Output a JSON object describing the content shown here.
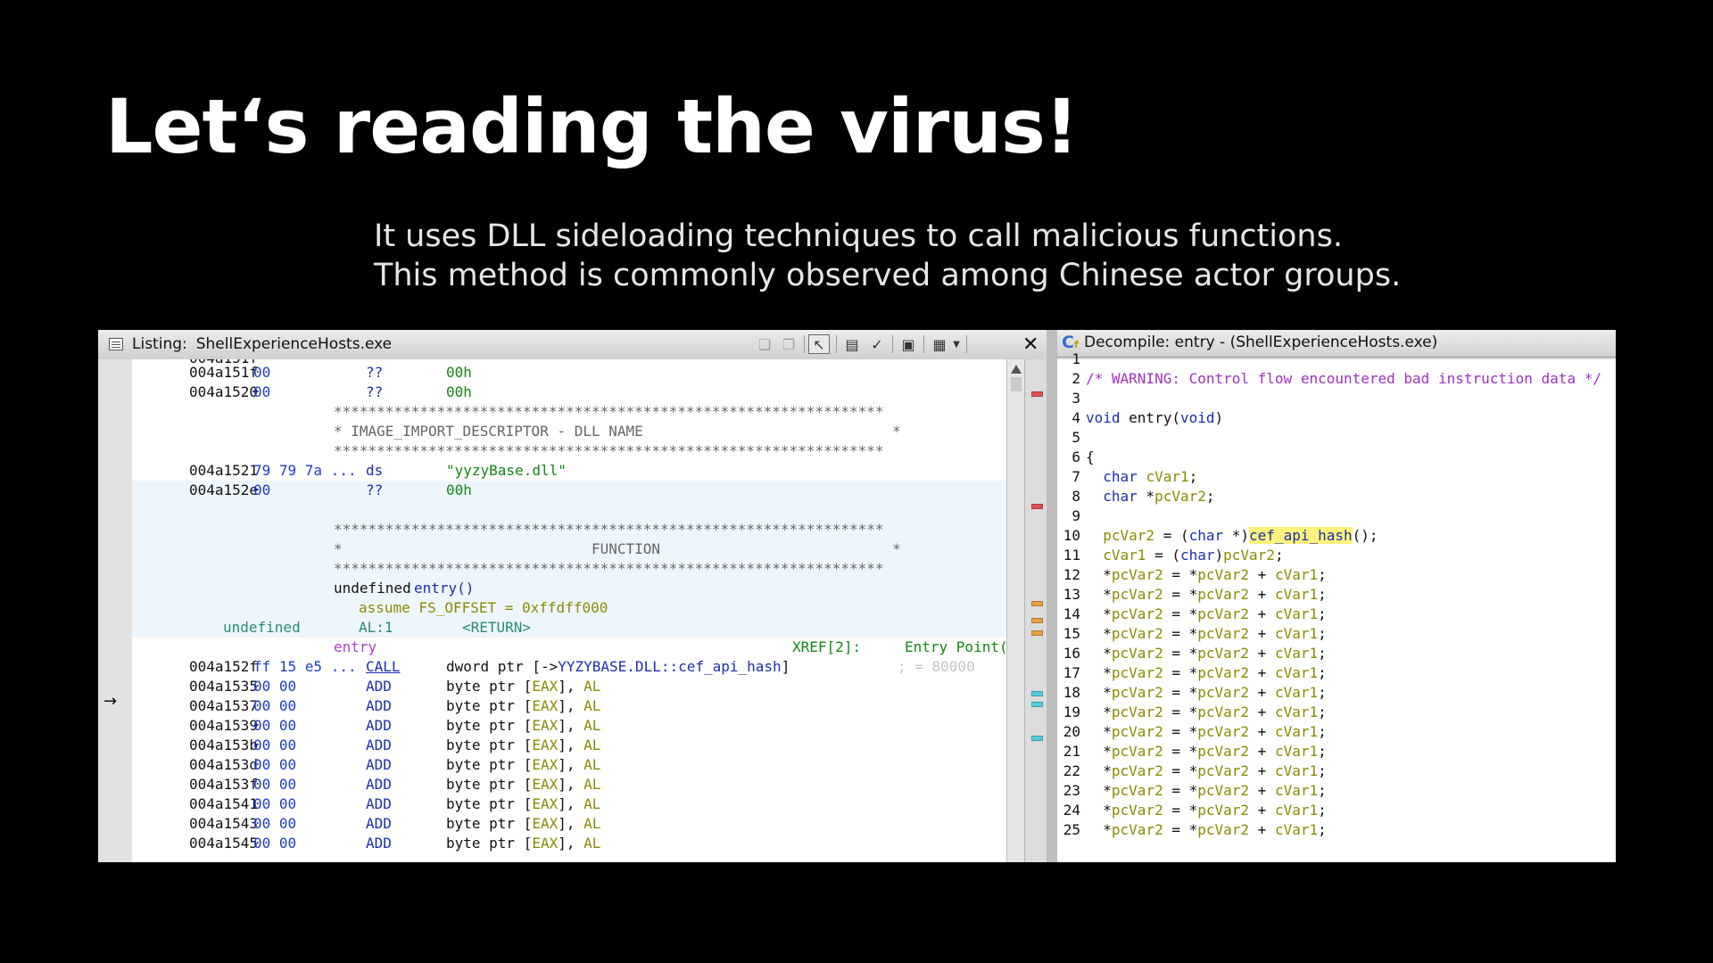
{
  "slide": {
    "title": "Let‘s reading the virus!",
    "subtitle_lines": [
      "It uses DLL sideloading techniques to call malicious functions.",
      "This method is commonly observed among Chinese actor groups."
    ]
  },
  "listing": {
    "label": "Listing:",
    "file": "ShellExperienceHosts.exe",
    "icons": [
      "copy-icon",
      "paste-icon",
      "cursor-select-icon",
      "field-layout-icon",
      "diff-icon",
      "snapshot-icon",
      "options-icon",
      "dropdown-arrow-icon",
      "close-icon"
    ],
    "rows": [
      {
        "addr": "004a151f",
        "bytes": "00",
        "mnem": "??",
        "op": "00h"
      },
      {
        "addr": "004a1520",
        "bytes": "00",
        "mnem": "??",
        "op": "00h"
      },
      {
        "stars": "****************************************************************"
      },
      {
        "comment": "* IMAGE_IMPORT_DESCRIPTOR - DLL NAME                             *"
      },
      {
        "stars": "****************************************************************"
      },
      {
        "addr": "004a1521",
        "bytes": "79 79 7a ...",
        "mnem": "ds",
        "op": "\"yyzyBase.dll\""
      },
      {
        "addr": "004a152e",
        "bytes": "00",
        "mnem": "??",
        "op": "00h"
      }
    ],
    "function_block": {
      "stars_top": "****************************************************************",
      "function_label": "*                             FUNCTION                           *",
      "stars_bottom": "****************************************************************",
      "sig_type": "undefined",
      "sig_name": "entry()",
      "assume": "assume FS_OFFSET = 0xffdff000",
      "ret_type": "undefined",
      "ret_reg": "AL:1",
      "ret_name": "<RETURN>",
      "label": "entry",
      "xref": "XREF[2]:",
      "entry_point": "Entry Point(",
      "call_addr": "004a152f",
      "call_bytes": "ff 15 e5 ...",
      "call_mnem": "CALL",
      "call_op_prefix": "dword ptr [->",
      "call_op_target": "YYZYBASE.DLL::cef_api_hash",
      "call_op_suffix": "]",
      "call_comment": "; = 80000"
    },
    "add_rows": [
      {
        "addr": "004a1535",
        "bytes": "00 00",
        "mnem": "ADD",
        "op1": "byte ptr [",
        "reg1": "EAX",
        "op2": "], ",
        "reg2": "AL"
      },
      {
        "addr": "004a1537",
        "bytes": "00 00",
        "mnem": "ADD",
        "op1": "byte ptr [",
        "reg1": "EAX",
        "op2": "], ",
        "reg2": "AL"
      },
      {
        "addr": "004a1539",
        "bytes": "00 00",
        "mnem": "ADD",
        "op1": "byte ptr [",
        "reg1": "EAX",
        "op2": "], ",
        "reg2": "AL"
      },
      {
        "addr": "004a153b",
        "bytes": "00 00",
        "mnem": "ADD",
        "op1": "byte ptr [",
        "reg1": "EAX",
        "op2": "], ",
        "reg2": "AL"
      },
      {
        "addr": "004a153d",
        "bytes": "00 00",
        "mnem": "ADD",
        "op1": "byte ptr [",
        "reg1": "EAX",
        "op2": "], ",
        "reg2": "AL"
      },
      {
        "addr": "004a153f",
        "bytes": "00 00",
        "mnem": "ADD",
        "op1": "byte ptr [",
        "reg1": "EAX",
        "op2": "], ",
        "reg2": "AL"
      },
      {
        "addr": "004a1541",
        "bytes": "00 00",
        "mnem": "ADD",
        "op1": "byte ptr [",
        "reg1": "EAX",
        "op2": "], ",
        "reg2": "AL"
      },
      {
        "addr": "004a1543",
        "bytes": "00 00",
        "mnem": "ADD",
        "op1": "byte ptr [",
        "reg1": "EAX",
        "op2": "], ",
        "reg2": "AL"
      },
      {
        "addr": "004a1545",
        "bytes": "00 00",
        "mnem": "ADD",
        "op1": "byte ptr [",
        "reg1": "EAX",
        "op2": "], ",
        "reg2": "AL"
      }
    ],
    "marker_colors": {
      "red": "#e05050",
      "orange": "#e8a040",
      "cyan": "#50d0e0"
    }
  },
  "decompile": {
    "icon_text": "C",
    "icon_sub": "f",
    "title": "Decompile: entry -  (ShellExperienceHosts.exe)",
    "line_numbers": [
      "1",
      "2",
      "3",
      "4",
      "5",
      "6",
      "7",
      "8",
      "9",
      "10",
      "11",
      "12",
      "13",
      "14",
      "15",
      "16",
      "17",
      "18",
      "19",
      "20",
      "21",
      "22",
      "23",
      "24",
      "25"
    ],
    "warning": "/* WARNING: Control flow encountered bad instruction data */",
    "void_kw": "void",
    "entry_decl": " entry(",
    "void_param": "void",
    "close_paren": ")",
    "brace": "{",
    "decl1_type": "char",
    "decl1_var": "cVar1",
    "decl2_type": "char",
    "decl2_star": " *",
    "decl2_var": "pcVar2",
    "semi": ";",
    "assign_lhs": "pcVar2",
    "assign_eq": " = (",
    "assign_cast": "char",
    "assign_star": " *)",
    "assign_fn": "cef_api_hash",
    "assign_tail": "();",
    "cvar_lhs": "cVar1",
    "cvar_eq": " = (",
    "cvar_cast": "char",
    "cvar_close": ")",
    "cvar_rhs": "pcVar2",
    "star": "*",
    "loop_var": "pcVar2",
    "loop_eq": " = ",
    "loop_plus": " + ",
    "loop_add": "cVar1"
  }
}
